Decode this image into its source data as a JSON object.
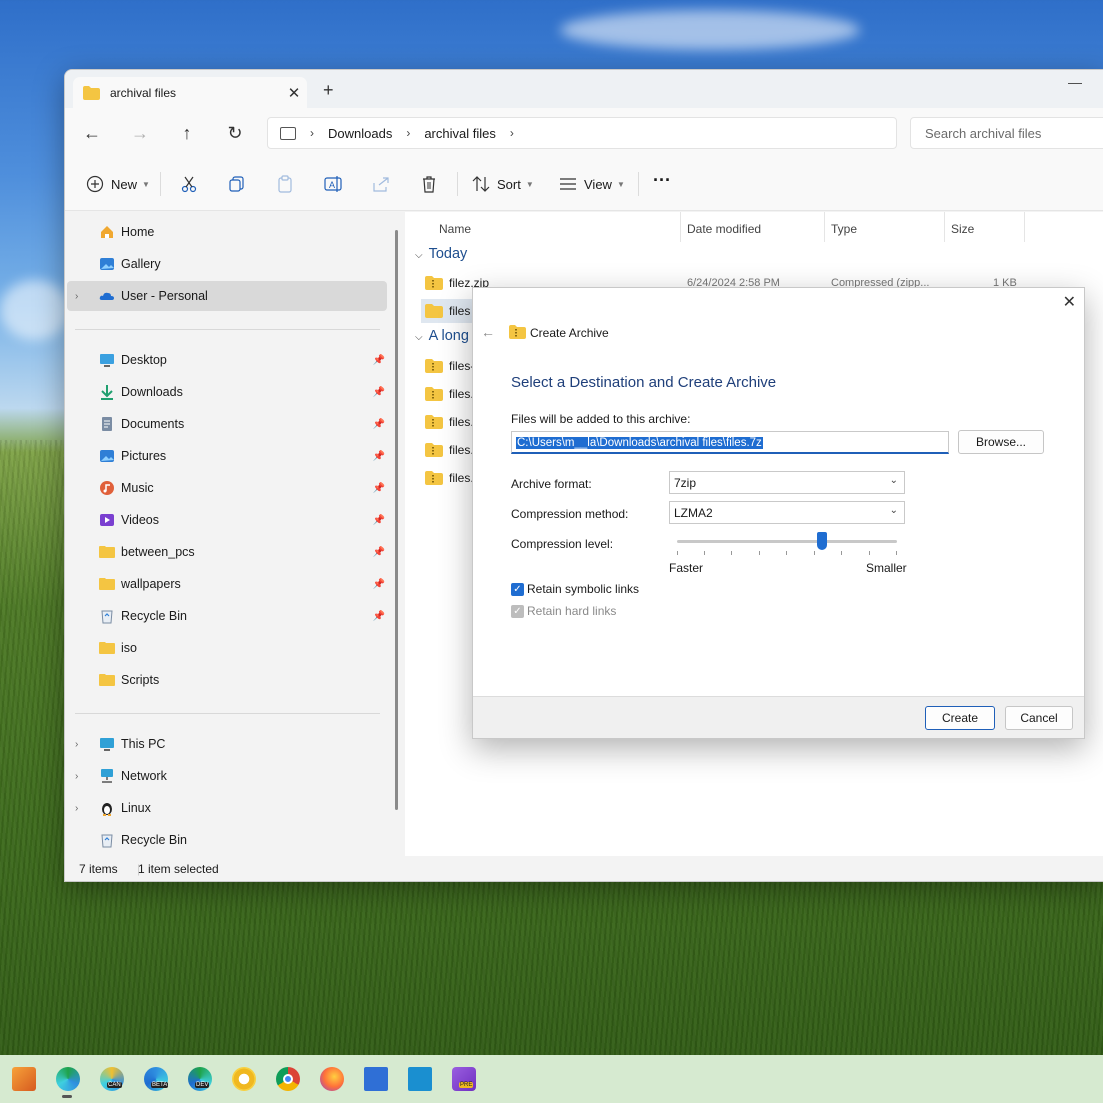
{
  "window": {
    "tab_title": "archival files",
    "close_glyph": "✕",
    "newtab_glyph": "+",
    "minimize_glyph": "—"
  },
  "address": {
    "segments": [
      "Downloads",
      "archival files"
    ],
    "search_placeholder": "Search archival files"
  },
  "toolbar": {
    "new_label": "New",
    "sort_label": "Sort",
    "view_label": "View",
    "more_label": "···"
  },
  "sidebar": {
    "items": [
      {
        "label": "Home",
        "icon": "home-icon"
      },
      {
        "label": "Gallery",
        "icon": "gallery-icon"
      },
      {
        "label": "User - Personal",
        "icon": "onedrive-icon"
      },
      {
        "label": "Desktop",
        "icon": "desktop-icon"
      },
      {
        "label": "Downloads",
        "icon": "download-icon"
      },
      {
        "label": "Documents",
        "icon": "documents-icon"
      },
      {
        "label": "Pictures",
        "icon": "pictures-icon"
      },
      {
        "label": "Music",
        "icon": "music-icon"
      },
      {
        "label": "Videos",
        "icon": "videos-icon"
      },
      {
        "label": "between_pcs",
        "icon": "folder-icon"
      },
      {
        "label": "wallpapers",
        "icon": "folder-icon"
      },
      {
        "label": "Recycle Bin",
        "icon": "recycle-bin-icon"
      },
      {
        "label": "iso",
        "icon": "folder-icon"
      },
      {
        "label": "Scripts",
        "icon": "folder-icon"
      },
      {
        "label": "This PC",
        "icon": "this-pc-icon"
      },
      {
        "label": "Network",
        "icon": "network-icon"
      },
      {
        "label": "Linux",
        "icon": "linux-icon"
      },
      {
        "label": "Recycle Bin",
        "icon": "recycle-bin-icon"
      }
    ]
  },
  "files": {
    "columns": [
      "Name",
      "Date modified",
      "Type",
      "Size"
    ],
    "groups": [
      "Today",
      "A long"
    ],
    "rows": [
      {
        "name": "filez.zip",
        "date": "6/24/2024 2:58 PM",
        "type": "Compressed (zipp...",
        "size": "1 KB"
      },
      {
        "name": "files"
      },
      {
        "name": "files-"
      },
      {
        "name": "files.g"
      },
      {
        "name": "files.r"
      },
      {
        "name": "files.t"
      },
      {
        "name": "files.z"
      }
    ]
  },
  "status": {
    "count": "7 items",
    "selected": "1 item selected"
  },
  "dialog": {
    "window_title": "Create Archive",
    "heading": "Select a Destination and Create Archive",
    "path_label": "Files will be added to this archive:",
    "path_value": "C:\\Users\\m__la\\Downloads\\archival files\\files.7z",
    "browse_label": "Browse...",
    "format_label": "Archive format:",
    "format_value": "7zip",
    "method_label": "Compression method:",
    "method_value": "LZMA2",
    "level_label": "Compression level:",
    "level_value": 0.66,
    "faster_label": "Faster",
    "smaller_label": "Smaller",
    "symlinks_label": "Retain symbolic links",
    "symlinks_checked": true,
    "hardlinks_label": "Retain hard links",
    "hardlinks_checked": true,
    "hardlinks_disabled": true,
    "create_label": "Create",
    "cancel_label": "Cancel"
  },
  "taskbar": {
    "badges": [
      "CAN",
      "BETA",
      "DEV",
      "PRE"
    ]
  },
  "colors": {
    "accent": "#1f6dd1",
    "folder": "#f4c542",
    "heading": "#1f3f7a"
  }
}
